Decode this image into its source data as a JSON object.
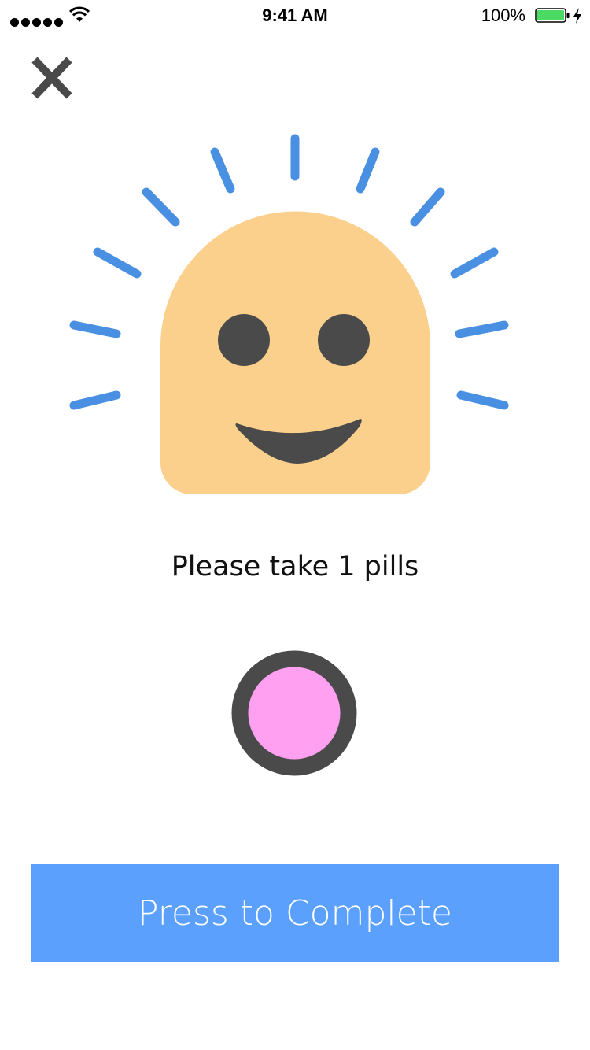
{
  "status_bar": {
    "time": "9:41 AM",
    "battery_percent": "100%",
    "signal_icon": "signal-dots-icon",
    "wifi_icon": "wifi-icon",
    "battery_icon": "battery-icon",
    "charging_icon": "charging-bolt-icon",
    "battery_color": "#4CD964"
  },
  "header": {
    "close_icon": "close-icon",
    "close_color": "#4A4A4A"
  },
  "mascot": {
    "icon": "smiling-sun-face-icon",
    "face_color": "#FAD08C",
    "feature_color": "#4A4A4A",
    "ray_color": "#4A90E2"
  },
  "main": {
    "instruction": "Please take 1 pills",
    "pill_icon": "pill-icon",
    "pill_color": "#FFA0F0",
    "pill_outline_color": "#4A4A4A"
  },
  "footer": {
    "complete_label": "Press to Complete",
    "button_color": "#5AA0FC"
  }
}
